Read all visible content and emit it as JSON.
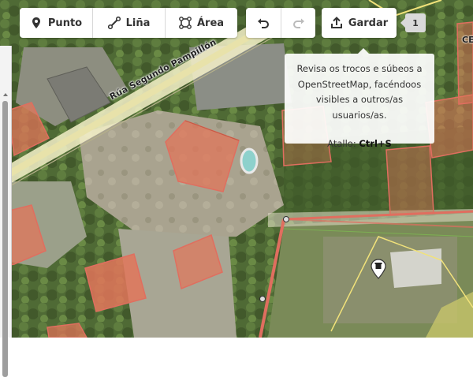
{
  "toolbar": {
    "modes": [
      {
        "label": "Punto",
        "icon": "pin-icon"
      },
      {
        "label": "Liña",
        "icon": "line-icon"
      },
      {
        "label": "Área",
        "icon": "area-icon"
      }
    ],
    "undo_icon": "undo-icon",
    "redo_icon": "redo-icon",
    "save_label": "Gardar",
    "save_icon": "upload-icon",
    "save_count": "1"
  },
  "tooltip": {
    "text": "Revisa os trocos e súbeos a OpenStreetMap, facéndoos visibles a outros/as usuarios/as.",
    "shortcut_label": "Atallo:",
    "shortcut_key": "Ctrl+S"
  },
  "map": {
    "street_name": "Rúa Segundo Pampillón",
    "corner_label": "CE",
    "colors": {
      "building_fill": "#e2765a",
      "building_outline": "#e06e5f",
      "road_casing": "#f5f1c9",
      "highlight": "#f1e27a",
      "selection": "#e06e5f"
    }
  }
}
